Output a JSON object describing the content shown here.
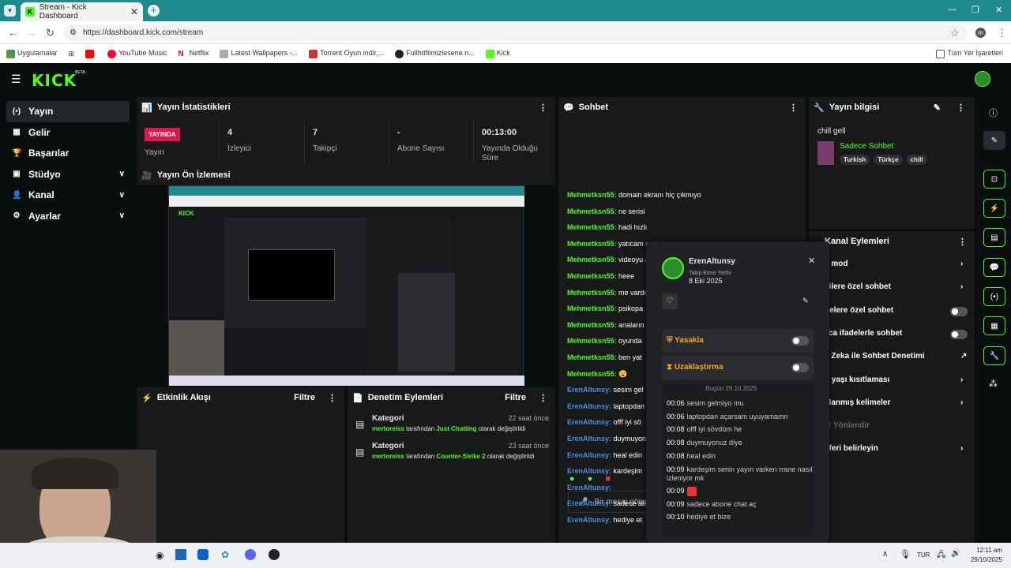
{
  "browser": {
    "tab_title": "Stream - Kick Dashboard",
    "url": "https://dashboard.kick.com/stream",
    "bookmarks": [
      "Uygulamalar",
      "YouTube Music",
      "Netflix",
      "Latest Wallpapers -...",
      "Torrent Oyun indir,...",
      "Fullhdfilmizlesene.n...",
      "Kick"
    ],
    "all_bookmarks": "Tüm Yer İşaretleri"
  },
  "sidebar": {
    "items": [
      {
        "label": "Yayın"
      },
      {
        "label": "Gelir"
      },
      {
        "label": "Başarılar"
      },
      {
        "label": "Stüdyo"
      },
      {
        "label": "Kanal"
      },
      {
        "label": "Ayarlar"
      }
    ]
  },
  "stats": {
    "title": "Yayın İstatistikleri",
    "live_badge": "YAYINDA",
    "items": [
      {
        "value": "",
        "label": "Yayın"
      },
      {
        "value": "4",
        "label": "İzleyici"
      },
      {
        "value": "7",
        "label": "Takipçi"
      },
      {
        "value": "-",
        "label": "Abone Sayısı"
      },
      {
        "value": "00:13:00",
        "label": "Yayında Olduğu Süre"
      }
    ]
  },
  "preview": {
    "title": "Yayın Ön İzlemesi"
  },
  "activity": {
    "title": "Etkinlik Akışı",
    "filter": "Filtre"
  },
  "moderation": {
    "title": "Denetim Eylemleri",
    "filter": "Filtre",
    "items": [
      {
        "title": "Kategori",
        "time": "22 saat önce",
        "user": "mertoreiss",
        "mid": "tarafından",
        "cat": "Just Chatting",
        "tail": "olarak değiştirildi"
      },
      {
        "title": "Kategori",
        "time": "23 saat önce",
        "user": "mertoreiss",
        "mid": "tarafından",
        "cat": "Counter-Strike 2",
        "tail": "olarak değiştirildi"
      }
    ]
  },
  "chat": {
    "title": "Sohbet",
    "input_placeholder": "Bir mesaj gönd",
    "messages": [
      {
        "user": "Mehmetksn55:",
        "text": "domain ekranı hiç çıkmıyo"
      },
      {
        "user": "Mehmetksn55:",
        "text": "ne serisi"
      },
      {
        "user": "Mehmetksn55:",
        "text": "hadi hızlı"
      },
      {
        "user": "Mehmetksn55:",
        "text": "yatıcam amk"
      },
      {
        "user": "Mehmetksn55:",
        "text": "videoyu aö"
      },
      {
        "user": "Mehmetksn55:",
        "text": "heee"
      },
      {
        "user": "Mehmetksn55:",
        "text": "me vardı"
      },
      {
        "user": "Mehmetksn55:",
        "text": "psikopa"
      },
      {
        "user": "Mehmetksn55:",
        "text": "anaların"
      },
      {
        "user": "Mehmetksn55:",
        "text": "oyunda"
      },
      {
        "user": "Mehmetksn55:",
        "text": "ben yat"
      },
      {
        "user": "Mehmetksn55:",
        "text": "😮"
      },
      {
        "user": "ErenAltunsy:",
        "text": "sesim gel"
      },
      {
        "user": "ErenAltunsy:",
        "text": "laptopdan"
      },
      {
        "user": "ErenAltunsy:",
        "text": "offf iyi sö"
      },
      {
        "user": "ErenAltunsy:",
        "text": "duymuyon"
      },
      {
        "user": "ErenAltunsy:",
        "text": "heal edin"
      },
      {
        "user": "ErenAltunsy:",
        "text": "kardeşim"
      },
      {
        "user": "ErenAltunsy:",
        "text": ""
      },
      {
        "user": "ErenAltunsy:",
        "text": "sadece ab"
      },
      {
        "user": "ErenAltunsy:",
        "text": "hediye et"
      }
    ]
  },
  "info": {
    "title": "Yayın bilgisi",
    "stream_title": "chill gell",
    "category": "Sadece Sohbet",
    "tags": [
      "Turkish",
      "Türkçe",
      "chill"
    ]
  },
  "channel_actions": {
    "title": "Kanal Eylemleri",
    "items": [
      {
        "label": "ş mod",
        "ctl": "chev"
      },
      {
        "label": "çilere özel sohbet",
        "ctl": "chev"
      },
      {
        "label": "nelere özel sohbet",
        "ctl": "toggle"
      },
      {
        "label": "zca ifadelerle sohbet",
        "ctl": "toggle"
      },
      {
        "label": "y Zeka ile Sohbet Denetimi",
        "ctl": "ext"
      },
      {
        "label": "p yaşı kısıtlaması",
        "ctl": "chev"
      },
      {
        "label": "klanmış kelimeler",
        "ctl": "chev"
      },
      {
        "label": "ci Yönlendir",
        "ctl": "none"
      },
      {
        "label": "eferi belirleyin",
        "ctl": "chev"
      }
    ]
  },
  "user_card": {
    "username": "ErenAltunsy",
    "follow_label": "Takip Etme Tarihi",
    "follow_date": "8 Eki 2025",
    "ban": "Yasakla",
    "timeout": "Uzaklaştırma",
    "date_header": "Bugün 29.10.2025",
    "messages": [
      {
        "t": "00:06",
        "m": "sesim gelmiyo mu"
      },
      {
        "t": "00:06",
        "m": "laptopdan açarsam uyuyamamn"
      },
      {
        "t": "00:08",
        "m": "offf iyi sövdüm he"
      },
      {
        "t": "00:08",
        "m": "duymuyonuz diye"
      },
      {
        "t": "00:08",
        "m": "heal edin"
      },
      {
        "t": "00:09",
        "m": "kardeşim senin yayın varken rrane nasıl izleniyor mk"
      },
      {
        "t": "00:09",
        "m": ""
      },
      {
        "t": "00:09",
        "m": "sadece abone chat aç"
      },
      {
        "t": "00:10",
        "m": "hediye et bize"
      }
    ]
  },
  "taskbar": {
    "lang": "TUR",
    "time": "12:11 am",
    "date": "29/10/2025"
  }
}
